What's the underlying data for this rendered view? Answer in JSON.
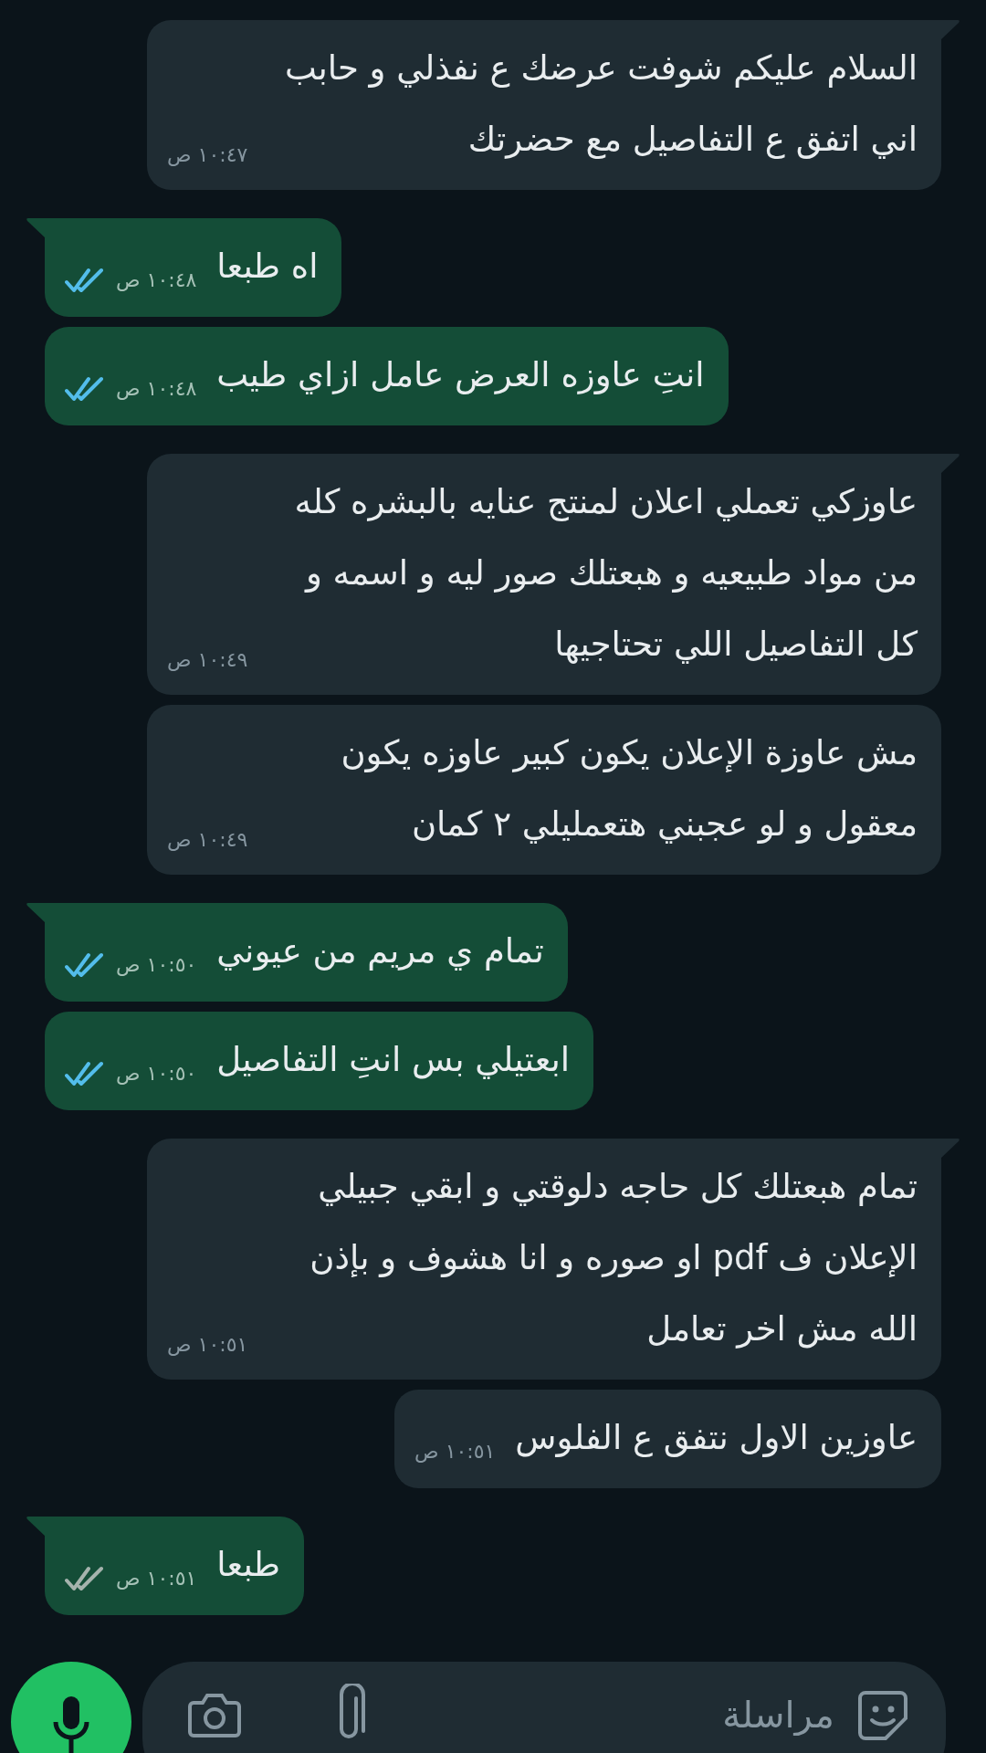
{
  "messages": [
    {
      "kind": "incoming",
      "tail": true,
      "text": "السلام عليكم شوفت عرضك ع نفذلي و حابب اني اتفق ع التفاصيل مع حضرتك",
      "time": "١٠:٤٧ ص"
    },
    {
      "kind": "outgoing",
      "tail": true,
      "text": "اه طبعا",
      "time": "١٠:٤٨ ص",
      "read": true
    },
    {
      "kind": "outgoing",
      "tail": false,
      "text": "انتِ عاوزه العرض عامل ازاي طيب",
      "time": "١٠:٤٨ ص",
      "read": true
    },
    {
      "kind": "incoming",
      "tail": true,
      "text": "عاوزكي تعملي اعلان لمنتج عنايه بالبشره كله من مواد طبيعيه و هبعتلك صور ليه و اسمه و كل التفاصيل اللي تحتاجيها",
      "time": "١٠:٤٩ ص"
    },
    {
      "kind": "incoming",
      "tail": false,
      "text": "مش عاوزة الإعلان يكون كبير عاوزه يكون معقول و لو عجبني هتعمليلي ٢ كمان",
      "time": "١٠:٤٩ ص"
    },
    {
      "kind": "outgoing",
      "tail": true,
      "text": "تمام ي مريم من عيوني",
      "time": "١٠:٥٠ ص",
      "read": true
    },
    {
      "kind": "outgoing",
      "tail": false,
      "text": "ابعتيلي بس انتِ التفاصيل",
      "time": "١٠:٥٠ ص",
      "read": true
    },
    {
      "kind": "incoming",
      "tail": true,
      "text": "تمام هبعتلك كل حاجه دلوقتي و ابقي جبيلي الإعلان ف pdf او صوره و انا هشوف و بإذن الله مش اخر تعامل",
      "time": "١٠:٥١ ص"
    },
    {
      "kind": "incoming",
      "tail": false,
      "text": "عاوزين الاول نتفق ع الفلوس",
      "time": "١٠:٥١ ص"
    },
    {
      "kind": "outgoing",
      "tail": true,
      "text": "طبعا",
      "time": "١٠:٥١ ص",
      "read": false
    }
  ],
  "composer": {
    "placeholder": "مراسلة"
  }
}
